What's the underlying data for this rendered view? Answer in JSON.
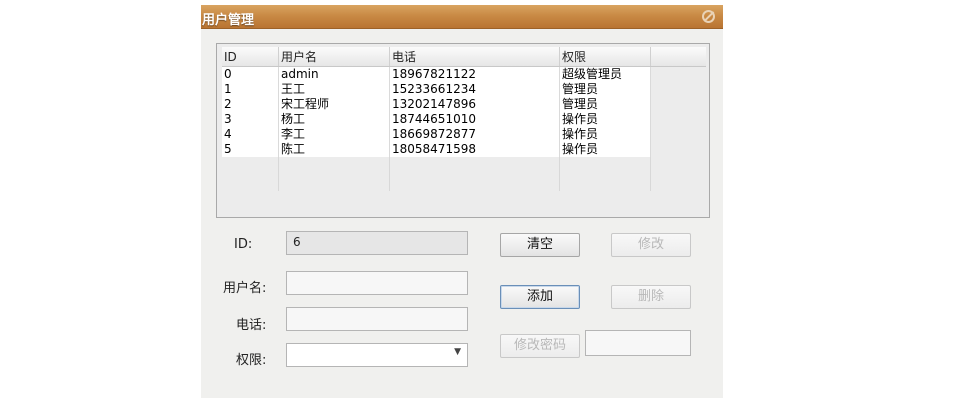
{
  "window": {
    "title": "用户管理"
  },
  "table": {
    "columns": [
      "ID",
      "用户名",
      "电话",
      "权限"
    ],
    "rows": [
      [
        "0",
        "admin",
        "18967821122",
        "超级管理员"
      ],
      [
        "1",
        "王工",
        "15233661234",
        "管理员"
      ],
      [
        "2",
        "宋工程师",
        "13202147896",
        "管理员"
      ],
      [
        "3",
        "杨工",
        "18744651010",
        "操作员"
      ],
      [
        "4",
        "李工",
        "18669872877",
        "操作员"
      ],
      [
        "5",
        "陈工",
        "18058471598",
        "操作员"
      ]
    ]
  },
  "form": {
    "id_label": "ID:",
    "id_value": "6",
    "username_label": "用户名:",
    "username_value": "",
    "phone_label": "电话:",
    "phone_value": "",
    "role_label": "权限:",
    "role_value": ""
  },
  "buttons": {
    "clear": "清空",
    "modify": "修改",
    "add": "添加",
    "delete": "删除",
    "change_password": "修改密码"
  },
  "password_field_value": ""
}
